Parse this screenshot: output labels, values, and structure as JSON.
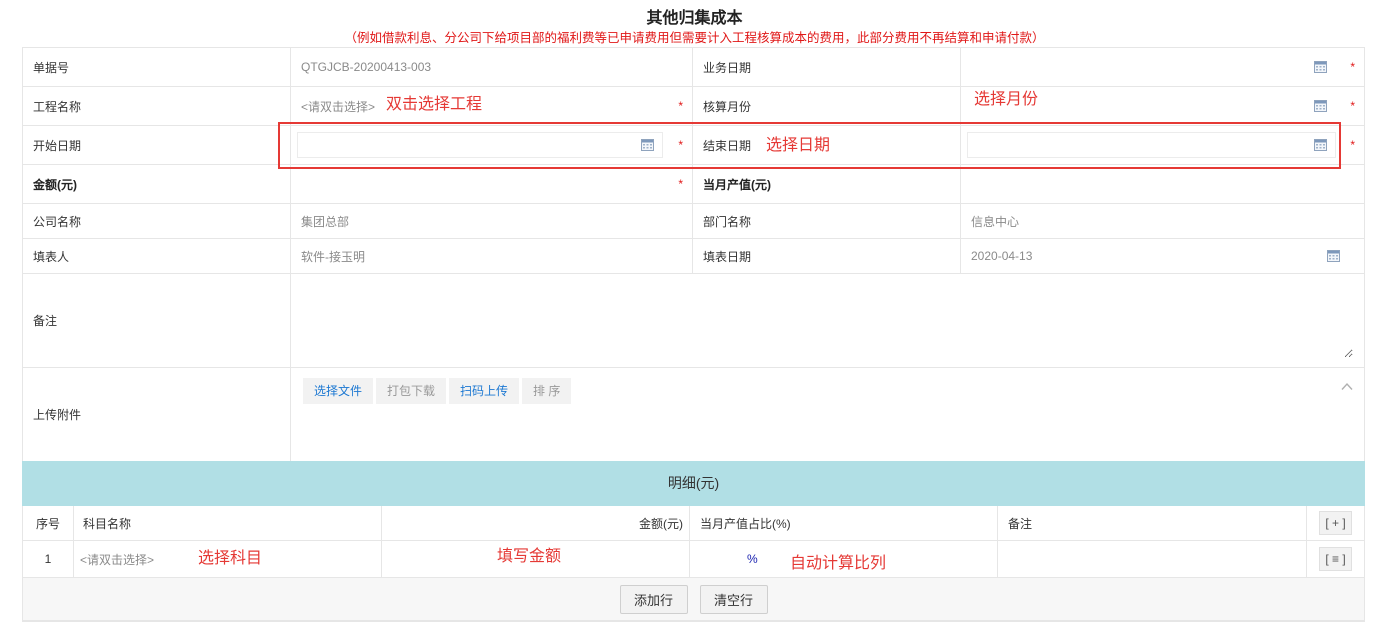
{
  "header": {
    "title": "其他归集成本",
    "subtitle": "（例如借款利息、分公司下给项目部的福利费等已申请费用但需要计入工程核算成本的费用，此部分费用不再结算和申请付款）"
  },
  "form": {
    "required_mark": "*",
    "doc_no_label": "单据号",
    "doc_no_value": "QTGJCB-20200413-003",
    "biz_date_label": "业务日期",
    "project_label": "工程名称",
    "project_placeholder": "<请双击选择>",
    "month_label": "核算月份",
    "start_label": "开始日期",
    "end_label": "结束日期",
    "amount_label": "金额(元)",
    "output_label": "当月产值(元)",
    "company_label": "公司名称",
    "company_value": "集团总部",
    "dept_label": "部门名称",
    "dept_value": "信息中心",
    "filler_label": "填表人",
    "filler_value": "软件-接玉明",
    "fill_date_label": "填表日期",
    "fill_date_value": "2020-04-13",
    "remark_label": "备注",
    "attach_label": "上传附件",
    "attach_buttons": [
      "选择文件",
      "打包下载",
      "扫码上传",
      "排 序"
    ]
  },
  "detail": {
    "title": "明细(元)",
    "columns": [
      "序号",
      "科目名称",
      "金额(元)",
      "当月产值占比(%)",
      "备注"
    ],
    "add_col_button": "[ + ]",
    "rows": [
      {
        "no": "1",
        "subject_placeholder": "<请双击选择>",
        "ratio_unit": "%",
        "menu_button": "[ ≡ ]"
      }
    ],
    "add_row_button": "添加行",
    "clear_row_button": "清空行"
  },
  "annotations": {
    "project": "双击选择工程",
    "month": "选择月份",
    "date": "选择日期",
    "subject": "选择科目",
    "amount": "填写金额",
    "ratio": "自动计算比列"
  },
  "icons": {
    "date_picker": "calendar-icon",
    "attach_toggle": "chevron-up-icon"
  },
  "colors": {
    "required": "#e01818",
    "annotation": "#e53935",
    "link": "#1c78d2",
    "detail_bar": "#b1dfe5"
  }
}
